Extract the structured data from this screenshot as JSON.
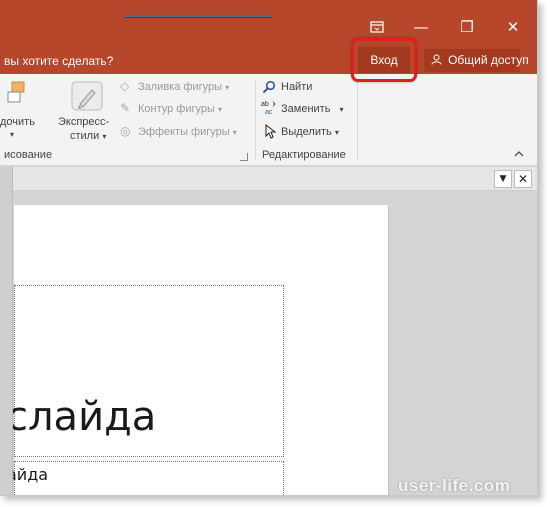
{
  "titlebar": {
    "ribbon_display_icon": "ribbon-display-options-icon",
    "minimize_glyph": "—",
    "restore_glyph": "❐",
    "close_glyph": "✕"
  },
  "tellme": {
    "text": "вы хотите сделать?"
  },
  "account": {
    "signin_label": "Вход",
    "share_label": "Общий доступ",
    "share_icon": "person-icon"
  },
  "ribbon": {
    "drawing": {
      "arrange_label": "дочить",
      "quick_styles_label_1": "Экспресс-",
      "quick_styles_label_2": "стили",
      "shape_fill": "Заливка фигуры",
      "shape_outline": "Контур фигуры",
      "shape_effects": "Эффекты фигуры",
      "group_name": "исование"
    },
    "editing": {
      "find": "Найти",
      "replace": "Заменить",
      "select": "Выделить",
      "group_name": "Редактирование"
    },
    "collapse_glyph": "^"
  },
  "pane": {
    "dropdown_glyph": "▼",
    "close_glyph": "✕"
  },
  "slide": {
    "title_text": "слайда",
    "subtitle_text": "айда"
  },
  "watermark": "user-life.com",
  "colors": {
    "accent": "#b7472a",
    "signin_highlight": "#e02020"
  }
}
